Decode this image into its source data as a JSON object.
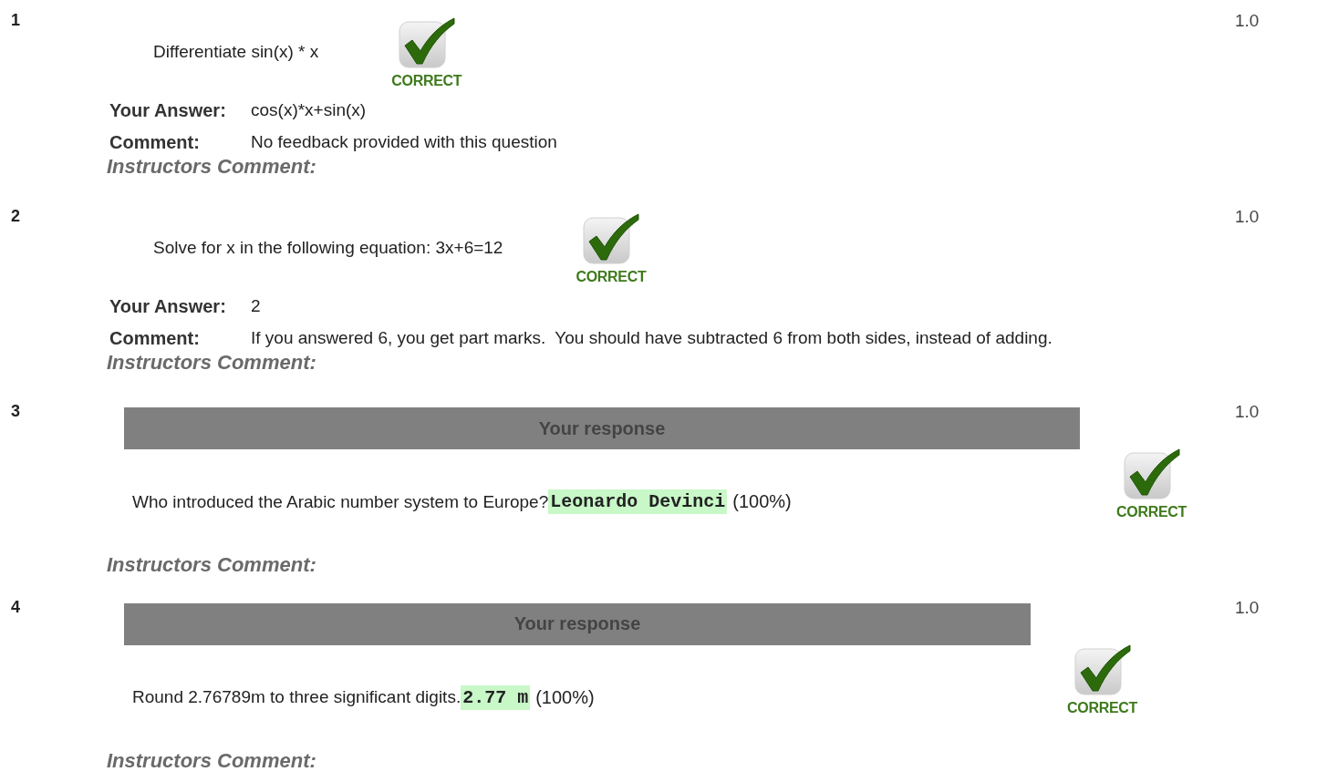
{
  "questions": [
    {
      "number": "1",
      "kind": "short",
      "question": "Differentiate sin(x) * x",
      "result": "CORRECT",
      "answer_label": "Your Answer:",
      "answer": "cos(x)*x+sin(x)",
      "comment_label": "Comment:",
      "comment": "No feedback provided with this question",
      "instructor_label": "Instructors Comment:",
      "score": "1.0"
    },
    {
      "number": "2",
      "kind": "short",
      "question": "Solve for x in the following equation: 3x+6=12",
      "result": "CORRECT",
      "answer_label": "Your Answer:",
      "answer": "2",
      "comment_label": "Comment:",
      "comment": "If you answered 6, you get part marks.  You should have subtracted 6 from both sides, instead of adding.",
      "instructor_label": "Instructors Comment:",
      "score": "1.0"
    },
    {
      "number": "3",
      "kind": "response",
      "header": "Your response",
      "question": "Who introduced the Arabic number system to Europe?",
      "answer": "Leonardo Devinci",
      "percent": "(100%)",
      "result": "CORRECT",
      "instructor_label": "Instructors Comment:",
      "score": "1.0"
    },
    {
      "number": "4",
      "kind": "response",
      "header": "Your response",
      "question": "Round 2.76789m to three significant digits.",
      "answer": "2.77 m",
      "percent": "(100%)",
      "result": "CORRECT",
      "instructor_label": "Instructors Comment:",
      "score": "1.0"
    }
  ]
}
